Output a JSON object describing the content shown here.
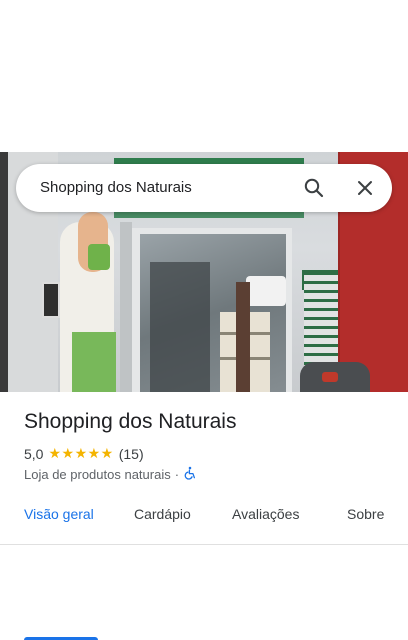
{
  "search": {
    "query": "Shopping dos Naturais"
  },
  "place": {
    "name": "Shopping dos Naturais",
    "rating": "5,0",
    "stars": "★★★★★",
    "review_count": "(15)",
    "category": "Loja de produtos naturais",
    "separator": "·"
  },
  "tabs": [
    {
      "label": "Visão geral"
    },
    {
      "label": "Cardápio"
    },
    {
      "label": "Avaliações"
    },
    {
      "label": "Sobre"
    }
  ],
  "colors": {
    "accent": "#1a73e8",
    "star": "#f4b400"
  }
}
